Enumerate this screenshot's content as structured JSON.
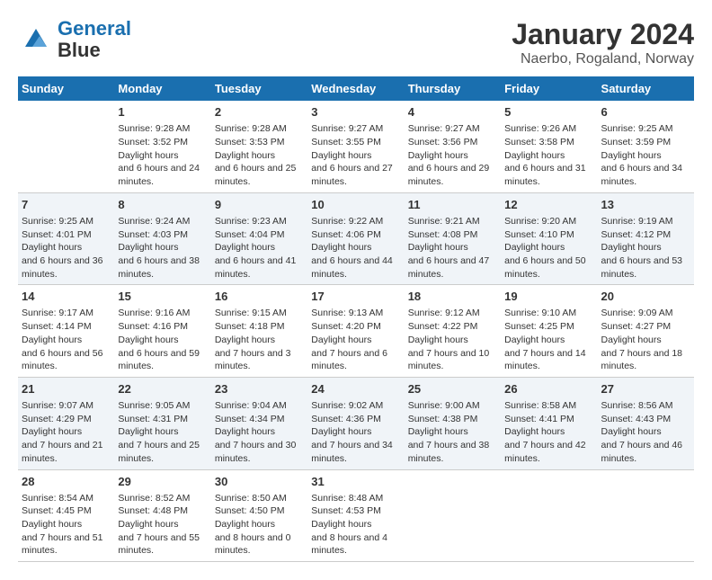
{
  "logo": {
    "line1": "General",
    "line2": "Blue"
  },
  "title": "January 2024",
  "subtitle": "Naerbo, Rogaland, Norway",
  "days_header": [
    "Sunday",
    "Monday",
    "Tuesday",
    "Wednesday",
    "Thursday",
    "Friday",
    "Saturday"
  ],
  "weeks": [
    [
      {
        "num": "",
        "sunrise": "",
        "sunset": "",
        "daylight": ""
      },
      {
        "num": "1",
        "sunrise": "9:28 AM",
        "sunset": "3:52 PM",
        "daylight": "6 hours and 24 minutes."
      },
      {
        "num": "2",
        "sunrise": "9:28 AM",
        "sunset": "3:53 PM",
        "daylight": "6 hours and 25 minutes."
      },
      {
        "num": "3",
        "sunrise": "9:27 AM",
        "sunset": "3:55 PM",
        "daylight": "6 hours and 27 minutes."
      },
      {
        "num": "4",
        "sunrise": "9:27 AM",
        "sunset": "3:56 PM",
        "daylight": "6 hours and 29 minutes."
      },
      {
        "num": "5",
        "sunrise": "9:26 AM",
        "sunset": "3:58 PM",
        "daylight": "6 hours and 31 minutes."
      },
      {
        "num": "6",
        "sunrise": "9:25 AM",
        "sunset": "3:59 PM",
        "daylight": "6 hours and 34 minutes."
      }
    ],
    [
      {
        "num": "7",
        "sunrise": "9:25 AM",
        "sunset": "4:01 PM",
        "daylight": "6 hours and 36 minutes."
      },
      {
        "num": "8",
        "sunrise": "9:24 AM",
        "sunset": "4:03 PM",
        "daylight": "6 hours and 38 minutes."
      },
      {
        "num": "9",
        "sunrise": "9:23 AM",
        "sunset": "4:04 PM",
        "daylight": "6 hours and 41 minutes."
      },
      {
        "num": "10",
        "sunrise": "9:22 AM",
        "sunset": "4:06 PM",
        "daylight": "6 hours and 44 minutes."
      },
      {
        "num": "11",
        "sunrise": "9:21 AM",
        "sunset": "4:08 PM",
        "daylight": "6 hours and 47 minutes."
      },
      {
        "num": "12",
        "sunrise": "9:20 AM",
        "sunset": "4:10 PM",
        "daylight": "6 hours and 50 minutes."
      },
      {
        "num": "13",
        "sunrise": "9:19 AM",
        "sunset": "4:12 PM",
        "daylight": "6 hours and 53 minutes."
      }
    ],
    [
      {
        "num": "14",
        "sunrise": "9:17 AM",
        "sunset": "4:14 PM",
        "daylight": "6 hours and 56 minutes."
      },
      {
        "num": "15",
        "sunrise": "9:16 AM",
        "sunset": "4:16 PM",
        "daylight": "6 hours and 59 minutes."
      },
      {
        "num": "16",
        "sunrise": "9:15 AM",
        "sunset": "4:18 PM",
        "daylight": "7 hours and 3 minutes."
      },
      {
        "num": "17",
        "sunrise": "9:13 AM",
        "sunset": "4:20 PM",
        "daylight": "7 hours and 6 minutes."
      },
      {
        "num": "18",
        "sunrise": "9:12 AM",
        "sunset": "4:22 PM",
        "daylight": "7 hours and 10 minutes."
      },
      {
        "num": "19",
        "sunrise": "9:10 AM",
        "sunset": "4:25 PM",
        "daylight": "7 hours and 14 minutes."
      },
      {
        "num": "20",
        "sunrise": "9:09 AM",
        "sunset": "4:27 PM",
        "daylight": "7 hours and 18 minutes."
      }
    ],
    [
      {
        "num": "21",
        "sunrise": "9:07 AM",
        "sunset": "4:29 PM",
        "daylight": "7 hours and 21 minutes."
      },
      {
        "num": "22",
        "sunrise": "9:05 AM",
        "sunset": "4:31 PM",
        "daylight": "7 hours and 25 minutes."
      },
      {
        "num": "23",
        "sunrise": "9:04 AM",
        "sunset": "4:34 PM",
        "daylight": "7 hours and 30 minutes."
      },
      {
        "num": "24",
        "sunrise": "9:02 AM",
        "sunset": "4:36 PM",
        "daylight": "7 hours and 34 minutes."
      },
      {
        "num": "25",
        "sunrise": "9:00 AM",
        "sunset": "4:38 PM",
        "daylight": "7 hours and 38 minutes."
      },
      {
        "num": "26",
        "sunrise": "8:58 AM",
        "sunset": "4:41 PM",
        "daylight": "7 hours and 42 minutes."
      },
      {
        "num": "27",
        "sunrise": "8:56 AM",
        "sunset": "4:43 PM",
        "daylight": "7 hours and 46 minutes."
      }
    ],
    [
      {
        "num": "28",
        "sunrise": "8:54 AM",
        "sunset": "4:45 PM",
        "daylight": "7 hours and 51 minutes."
      },
      {
        "num": "29",
        "sunrise": "8:52 AM",
        "sunset": "4:48 PM",
        "daylight": "7 hours and 55 minutes."
      },
      {
        "num": "30",
        "sunrise": "8:50 AM",
        "sunset": "4:50 PM",
        "daylight": "8 hours and 0 minutes."
      },
      {
        "num": "31",
        "sunrise": "8:48 AM",
        "sunset": "4:53 PM",
        "daylight": "8 hours and 4 minutes."
      },
      {
        "num": "",
        "sunrise": "",
        "sunset": "",
        "daylight": ""
      },
      {
        "num": "",
        "sunrise": "",
        "sunset": "",
        "daylight": ""
      },
      {
        "num": "",
        "sunrise": "",
        "sunset": "",
        "daylight": ""
      }
    ]
  ]
}
